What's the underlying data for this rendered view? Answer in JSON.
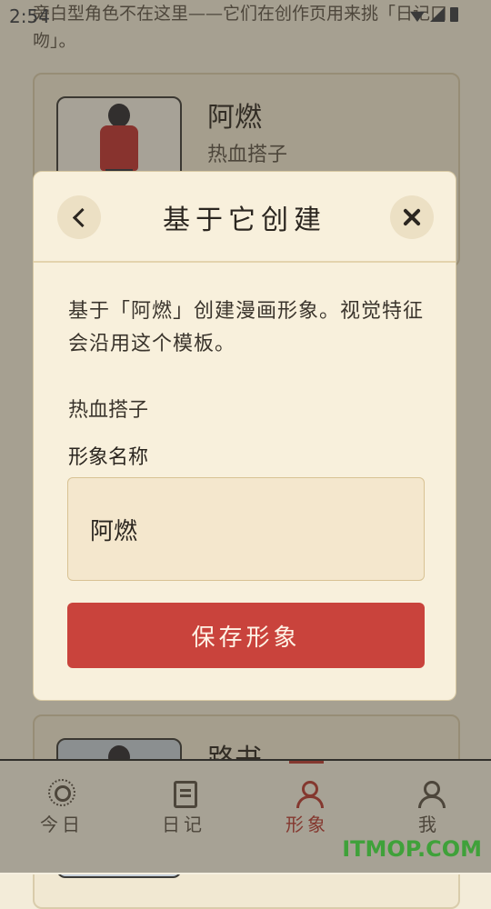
{
  "status_bar": {
    "time": "2:54"
  },
  "background": {
    "intro_text": "旁白型角色不在这里——它们在创作页用来挑「日记口吻」。",
    "cards": [
      {
        "name": "阿燃",
        "subtitle": "热血搭子"
      },
      {
        "name": "路书",
        "subtitle": ""
      }
    ]
  },
  "modal": {
    "title": "基于它创建",
    "description": "基于「阿燃」创建漫画形象。视觉特征会沿用这个模板。",
    "tag": "热血搭子",
    "field_label": "形象名称",
    "name_value": "阿燃",
    "save_label": "保存形象"
  },
  "nav": [
    {
      "label": "今日",
      "icon": "sun-icon",
      "active": false
    },
    {
      "label": "日记",
      "icon": "note-icon",
      "active": false
    },
    {
      "label": "形象",
      "icon": "person-icon",
      "active": true
    },
    {
      "label": "我",
      "icon": "person-icon",
      "active": false
    }
  ],
  "watermark": "ITMOP.COM",
  "colors": {
    "accent": "#c9433c",
    "modal_bg": "#f8f0dc",
    "active_nav": "#b93a31"
  }
}
